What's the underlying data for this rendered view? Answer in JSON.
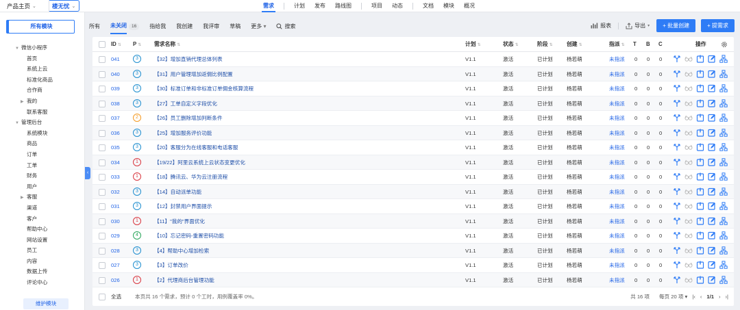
{
  "topnav": {
    "crumb_product": "产品主页",
    "crumb_current": "楼无忧",
    "items": [
      "需求",
      "计划",
      "发布",
      "路线图",
      "项目",
      "动态",
      "文档",
      "模块",
      "概况"
    ]
  },
  "sidebar": {
    "all_modules": "所有模块",
    "tree": [
      {
        "label": "微信小程序",
        "level": 0,
        "expand": "down"
      },
      {
        "label": "首页",
        "level": 1
      },
      {
        "label": "系统上云",
        "level": 1
      },
      {
        "label": "标准化商品",
        "level": 1
      },
      {
        "label": "合作商",
        "level": 1
      },
      {
        "label": "我的",
        "level": 1,
        "expand": "right"
      },
      {
        "label": "联系客服",
        "level": 1
      },
      {
        "label": "管理后台",
        "level": 0,
        "expand": "down"
      },
      {
        "label": "系统模块",
        "level": 1
      },
      {
        "label": "商品",
        "level": 1
      },
      {
        "label": "订单",
        "level": 1
      },
      {
        "label": "工单",
        "level": 1
      },
      {
        "label": "财务",
        "level": 1
      },
      {
        "label": "用户",
        "level": 1
      },
      {
        "label": "客服",
        "level": 1,
        "expand": "right"
      },
      {
        "label": "渠道",
        "level": 1
      },
      {
        "label": "客户",
        "level": 1
      },
      {
        "label": "帮助中心",
        "level": 1
      },
      {
        "label": "网站设置",
        "level": 1
      },
      {
        "label": "员工",
        "level": 1
      },
      {
        "label": "内容",
        "level": 1
      },
      {
        "label": "数据上传",
        "level": 1
      },
      {
        "label": "评论中心",
        "level": 1
      }
    ],
    "maintain_button": "维护模块"
  },
  "filters": {
    "tabs": [
      "所有",
      "未关闭",
      "指给我",
      "我创建",
      "我评审",
      "草稿",
      "更多"
    ],
    "active_tab": "未关闭",
    "unclosed_count": "16",
    "search_label": "搜索",
    "report_label": "报表",
    "export_label": "导出",
    "batch_create_label": "批量创建",
    "create_label": "提需求"
  },
  "table": {
    "headers": {
      "id": "ID",
      "pri": "P",
      "title": "需求名称",
      "plan": "计划",
      "status": "状态",
      "stage": "阶段",
      "creator": "创建",
      "assign": "指派",
      "t": "T",
      "b": "B",
      "c": "C",
      "ops": "操作"
    },
    "rows": [
      {
        "id": "041",
        "pri": "3",
        "title": "【32】增加直销代理总体列表",
        "plan": "V1.1",
        "status": "激活",
        "stage": "已计划",
        "creator": "杨若萌",
        "assign": "未指派",
        "t": "0",
        "b": "0",
        "c": "0"
      },
      {
        "id": "040",
        "pri": "3",
        "title": "【31】用户管理增加返佣比例配置",
        "plan": "V1.1",
        "status": "激活",
        "stage": "已计划",
        "creator": "杨若萌",
        "assign": "未指派",
        "t": "0",
        "b": "0",
        "c": "0"
      },
      {
        "id": "039",
        "pri": "3",
        "title": "【30】标准订单和非标准订单佣金核算流程",
        "plan": "V1.1",
        "status": "激活",
        "stage": "已计划",
        "creator": "杨若萌",
        "assign": "未指派",
        "t": "0",
        "b": "0",
        "c": "0"
      },
      {
        "id": "038",
        "pri": "3",
        "title": "【27】工单自定义字段优化",
        "plan": "V1.1",
        "status": "激活",
        "stage": "已计划",
        "creator": "杨若萌",
        "assign": "未指派",
        "t": "0",
        "b": "0",
        "c": "0"
      },
      {
        "id": "037",
        "pri": "2",
        "title": "【26】员工删除增加判断条件",
        "plan": "V1.1",
        "status": "激活",
        "stage": "已计划",
        "creator": "杨若萌",
        "assign": "未指派",
        "t": "0",
        "b": "0",
        "c": "0"
      },
      {
        "id": "036",
        "pri": "3",
        "title": "【25】增加服务评价功能",
        "plan": "V1.1",
        "status": "激活",
        "stage": "已计划",
        "creator": "杨若萌",
        "assign": "未指派",
        "t": "0",
        "b": "0",
        "c": "0"
      },
      {
        "id": "035",
        "pri": "3",
        "title": "【20】客服分为在线客服和电话客服",
        "plan": "V1.1",
        "status": "激活",
        "stage": "已计划",
        "creator": "杨若萌",
        "assign": "未指派",
        "t": "0",
        "b": "0",
        "c": "0"
      },
      {
        "id": "034",
        "pri": "1",
        "title": "【19/22】阿里云系统上云状态变更优化",
        "plan": "V1.1",
        "status": "激活",
        "stage": "已计划",
        "creator": "杨若萌",
        "assign": "未指派",
        "t": "0",
        "b": "0",
        "c": "0"
      },
      {
        "id": "033",
        "pri": "1",
        "title": "【18】腾讯云、华为云注册流程",
        "plan": "V1.1",
        "status": "激活",
        "stage": "已计划",
        "creator": "杨若萌",
        "assign": "未指派",
        "t": "0",
        "b": "0",
        "c": "0"
      },
      {
        "id": "032",
        "pri": "3",
        "title": "【14】自动派单功能",
        "plan": "V1.1",
        "status": "激活",
        "stage": "已计划",
        "creator": "杨若萌",
        "assign": "未指派",
        "t": "0",
        "b": "0",
        "c": "0"
      },
      {
        "id": "031",
        "pri": "3",
        "title": "【12】封禁用户界面提示",
        "plan": "V1.1",
        "status": "激活",
        "stage": "已计划",
        "creator": "杨若萌",
        "assign": "未指派",
        "t": "0",
        "b": "0",
        "c": "0"
      },
      {
        "id": "030",
        "pri": "1",
        "title": "【11】\"我的\"界面优化",
        "plan": "V1.1",
        "status": "激活",
        "stage": "已计划",
        "creator": "杨若萌",
        "assign": "未指派",
        "t": "0",
        "b": "0",
        "c": "0"
      },
      {
        "id": "029",
        "pri": "4",
        "title": "【10】忘记密码-重置密码功能",
        "plan": "V1.1",
        "status": "激活",
        "stage": "已计划",
        "creator": "杨若萌",
        "assign": "未指派",
        "t": "0",
        "b": "0",
        "c": "0"
      },
      {
        "id": "028",
        "pri": "3",
        "title": "【4】帮助中心增加检索",
        "plan": "V1.1",
        "status": "激活",
        "stage": "已计划",
        "creator": "杨若萌",
        "assign": "未指派",
        "t": "0",
        "b": "0",
        "c": "0"
      },
      {
        "id": "027",
        "pri": "3",
        "title": "【3】订单改价",
        "plan": "V1.1",
        "status": "激活",
        "stage": "已计划",
        "creator": "杨若萌",
        "assign": "未指派",
        "t": "0",
        "b": "0",
        "c": "0"
      },
      {
        "id": "026",
        "pri": "1",
        "title": "【2】代理商后台管理功能",
        "plan": "V1.1",
        "status": "激活",
        "stage": "已计划",
        "creator": "杨若萌",
        "assign": "未指派",
        "t": "0",
        "b": "0",
        "c": "0"
      }
    ],
    "pri_colors": {
      "1": "#d9363e",
      "2": "#f59a23",
      "3": "#1f8ecf",
      "4": "#2aa55a"
    },
    "footer": {
      "select_all": "全选",
      "summary": "本页共 16 个需求，预计 0 个工时，用例覆盖率 0%。",
      "total": "共 16 项",
      "per_page": "每页 20 项",
      "page": "1/1"
    }
  }
}
